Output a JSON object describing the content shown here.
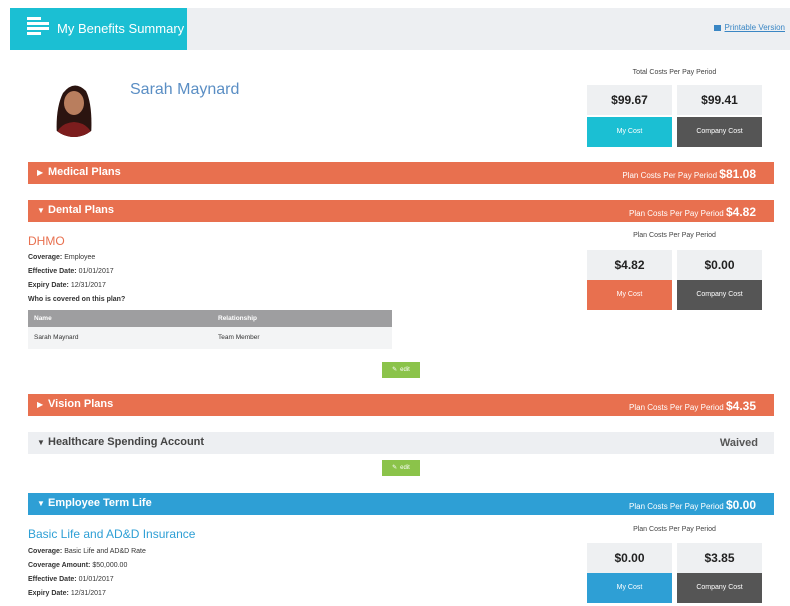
{
  "header": {
    "title": "My Benefits Summary",
    "printable_label": "Printable Version"
  },
  "user": {
    "name": "Sarah Maynard"
  },
  "total": {
    "label": "Total Costs Per Pay Period",
    "my_cost": "$99.67",
    "company_cost": "$99.41",
    "my_cost_label": "My Cost",
    "company_cost_label": "Company Cost"
  },
  "colors": {
    "accent": "#1bbfd3",
    "orange": "#e8704f",
    "blue": "#2e9fd5",
    "company_dark": "#555555",
    "edit_green": "#8bc34a"
  },
  "plan_costs_label": "Plan Costs Per Pay Period",
  "medical": {
    "title": "Medical Plans",
    "amount": "$81.08"
  },
  "dental": {
    "title": "Dental Plans",
    "amount": "$4.82",
    "plan_name": "DHMO",
    "coverage_label": "Coverage:",
    "coverage": "Employee",
    "effective_label": "Effective Date:",
    "effective": "01/01/2017",
    "expiry_label": "Expiry Date:",
    "expiry": "12/31/2017",
    "covered_question": "Who is covered on this plan?",
    "columns": [
      "Name",
      "Relationship"
    ],
    "rows": [
      [
        "Sarah Maynard",
        "Team Member"
      ]
    ],
    "my_cost": "$4.82",
    "company_cost": "$0.00"
  },
  "edit_label": "edit",
  "vision": {
    "title": "Vision Plans",
    "amount": "$4.35"
  },
  "hsa": {
    "title": "Healthcare Spending Account",
    "status": "Waived"
  },
  "life": {
    "title": "Employee Term Life",
    "amount": "$0.00",
    "plan_name": "Basic Life and AD&D Insurance",
    "coverage_label": "Coverage:",
    "coverage": "Basic Life and AD&D Rate",
    "amount_label": "Coverage Amount:",
    "coverage_amount": "$50,000.00",
    "effective_label": "Effective Date:",
    "effective": "01/01/2017",
    "expiry_label": "Expiry Date:",
    "expiry": "12/31/2017",
    "my_cost": "$0.00",
    "company_cost": "$3.85"
  }
}
